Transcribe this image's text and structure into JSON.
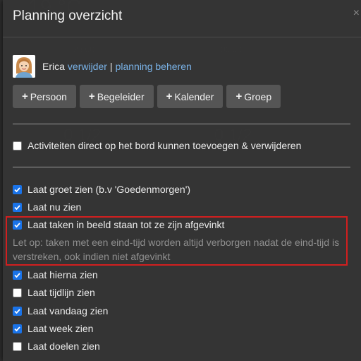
{
  "dialog": {
    "title": "Planning overzicht",
    "close_symbol": "×"
  },
  "user": {
    "name": "Erica",
    "remove_link": "verwijder",
    "separator": "|",
    "manage_link": "planning beheren",
    "avatar_icon": "avatar-icon"
  },
  "buttons": [
    {
      "label": "Persoon",
      "icon": "plus-icon"
    },
    {
      "label": "Begeleider",
      "icon": "plus-icon"
    },
    {
      "label": "Kalender",
      "icon": "plus-icon"
    },
    {
      "label": "Groep",
      "icon": "plus-icon"
    }
  ],
  "options": {
    "direct_edit": {
      "label": "Activiteiten direct op het bord kunnen toevoegen & verwijderen",
      "checked": false
    },
    "greeting": {
      "label": "Laat groet zien (b.v 'Goedenmorgen')",
      "checked": true
    },
    "now": {
      "label": "Laat nu zien",
      "checked": true
    },
    "keep_tasks": {
      "label": "Laat taken in beeld staan tot ze zijn afgevinkt",
      "checked": true
    },
    "keep_tasks_note": "Let op: taken met een eind-tijd worden altijd verborgen nadat de eind-tijd is verstreken, ook indien niet afgevinkt",
    "after": {
      "label": "Laat hierna zien",
      "checked": true
    },
    "timeline": {
      "label": "Laat tijdlijn zien",
      "checked": false
    },
    "today": {
      "label": "Laat vandaag zien",
      "checked": true
    },
    "week": {
      "label": "Laat week zien",
      "checked": true
    },
    "goals": {
      "label": "Laat doelen zien",
      "checked": false
    }
  },
  "colors": {
    "accent_link": "#7ab3e8",
    "checkbox_checked": "#1a73e8",
    "highlight_border": "#d21f1f"
  }
}
